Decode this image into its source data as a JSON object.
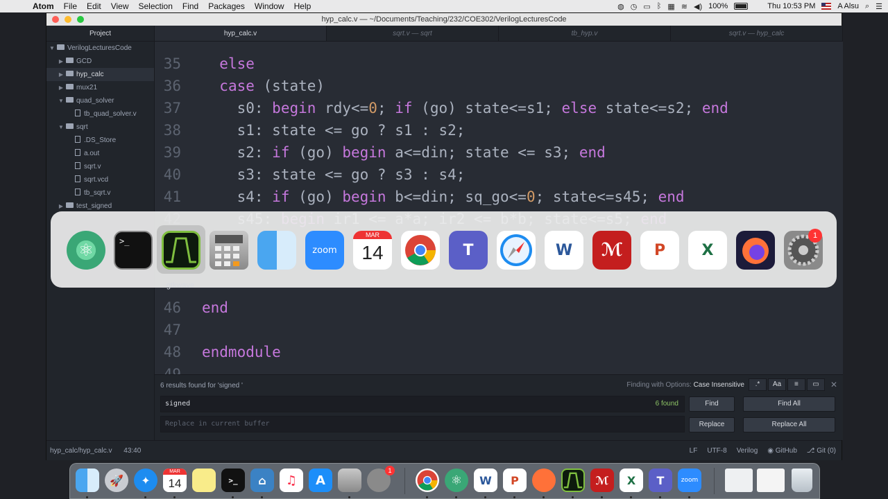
{
  "menubar": {
    "apple": "",
    "app_name": "Atom",
    "items": [
      "File",
      "Edit",
      "View",
      "Selection",
      "Find",
      "Packages",
      "Window",
      "Help"
    ],
    "battery": "100%",
    "clock": "Thu 10:53 PM",
    "user": "A Alsu"
  },
  "window": {
    "title": "hyp_calc.v — ~/Documents/Teaching/232/COE302/VerilogLecturesCode"
  },
  "tree": {
    "header": "Project",
    "items": [
      {
        "label": "VerilogLecturesCode",
        "type": "folder",
        "open": true
      },
      {
        "label": "GCD",
        "type": "folder",
        "open": false
      },
      {
        "label": "hyp_calc",
        "type": "folder",
        "open": false
      },
      {
        "label": "mux21",
        "type": "folder",
        "open": false
      },
      {
        "label": "quad_solver",
        "type": "folder",
        "open": true
      },
      {
        "label": "tb_quad_solver.v",
        "type": "file"
      },
      {
        "label": "sqrt",
        "type": "folder",
        "open": true
      },
      {
        "label": ".DS_Store",
        "type": "file"
      },
      {
        "label": "a.out",
        "type": "file"
      },
      {
        "label": "sqrt.v",
        "type": "file"
      },
      {
        "label": "sqrt.vcd",
        "type": "file"
      },
      {
        "label": "tb_sqrt.v",
        "type": "file"
      },
      {
        "label": "test_signed",
        "type": "folder",
        "open": false
      }
    ]
  },
  "tabs": [
    "hyp_calc.v",
    "sqrt.v — sqrt",
    "tb_hyp.v",
    "sqrt.v — hyp_calc"
  ],
  "editor": {
    "lines": [
      {
        "n": "35",
        "code": "  else"
      },
      {
        "n": "36",
        "code": "  case (state)"
      },
      {
        "n": "37",
        "code": "    s0: begin rdy<=0; if (go) state<=s1; else state<=s2; end"
      },
      {
        "n": "38",
        "code": "    s1: state <= go ? s1 : s2;"
      },
      {
        "n": "39",
        "code": "    s2: if (go) begin a<=din; state <= s3; end"
      },
      {
        "n": "40",
        "code": "    s3: state <= go ? s3 : s4;"
      },
      {
        "n": "41",
        "code": "    s4: if (go) begin b<=din; sq_go<=0; state<=s45; end"
      },
      {
        "n": "42",
        "code": "    s45: begin ir1 <= a*a; ir2 <= b*b; state<=s5; end"
      },
      {
        "n": "46",
        "code": "end"
      },
      {
        "n": "47",
        "code": ""
      },
      {
        "n": "48",
        "code": "endmodule"
      },
      {
        "n": "49",
        "code": ""
      }
    ]
  },
  "find": {
    "status": "6 results found for 'signed '",
    "options_label": "Finding with Options:",
    "options_value": "Case Insensitive",
    "opt_regex": ".*",
    "opt_case": "Aa",
    "opt_selection": "≡",
    "opt_word": "▭",
    "close": "✕",
    "query": "signed",
    "count": "6 found",
    "replace_placeholder": "Replace in current buffer",
    "find_btn": "Find",
    "find_all_btn": "Find All",
    "replace_btn": "Replace",
    "replace_all_btn": "Replace All"
  },
  "statusbar": {
    "path": "hyp_calc/hyp_calc.v",
    "cursor": "43:40",
    "eol": "LF",
    "encoding": "UTF-8",
    "grammar": "Verilog",
    "github": "GitHub",
    "git": "Git (0)"
  },
  "switcher": {
    "selected_label": "gtkwave",
    "apps": [
      "atom",
      "terminal",
      "gtkwave",
      "calculator",
      "finder",
      "zoom",
      "calendar",
      "chrome",
      "teams",
      "safari",
      "word",
      "acrobat",
      "powerpoint",
      "excel",
      "firefox",
      "system-preferences"
    ],
    "calendar_month": "MAR",
    "calendar_day": "14",
    "zoom_label": "zoom",
    "sysprefs_badge": "1"
  },
  "dock": {
    "calendar_month": "MAR",
    "calendar_day": "14",
    "zoom_label": "zoom",
    "sysprefs_badge": "1"
  },
  "colors": {
    "keyword": "#c678dd",
    "number": "#d19a66",
    "text": "#abb2bf",
    "found": "#8cc265"
  }
}
